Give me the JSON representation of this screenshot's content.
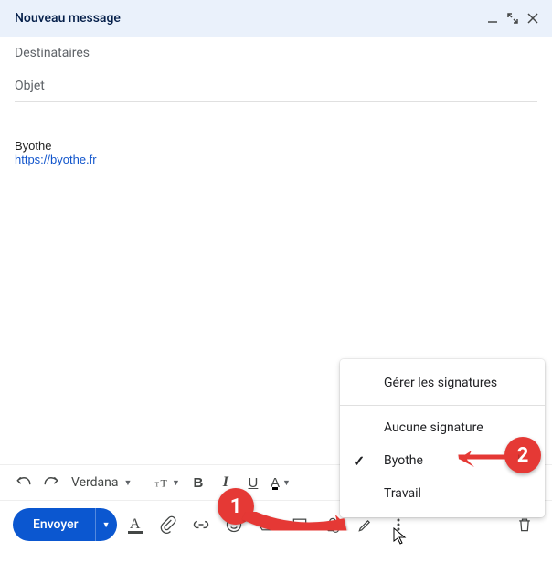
{
  "window": {
    "title": "Nouveau message"
  },
  "fields": {
    "recipients_placeholder": "Destinataires",
    "subject_placeholder": "Objet"
  },
  "body": {
    "signature_name": "Byothe",
    "signature_url_text": "https://byothe.fr",
    "signature_url_href": "https://byothe.fr"
  },
  "format_toolbar": {
    "font_name": "Verdana"
  },
  "bottom_bar": {
    "send_label": "Envoyer"
  },
  "signature_menu": {
    "manage_label": "Gérer les signatures",
    "none_label": "Aucune signature",
    "items": [
      {
        "label": "Byothe",
        "selected": true
      },
      {
        "label": "Travail",
        "selected": false
      }
    ]
  },
  "annotations": {
    "one": "1",
    "two": "2"
  }
}
